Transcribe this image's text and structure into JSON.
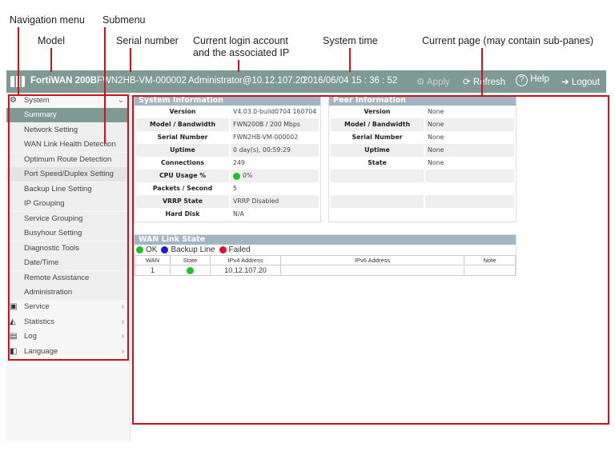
{
  "annotations": {
    "nav_menu": "Navigation menu",
    "submenu": "Submenu",
    "model": "Model",
    "serial": "Serial number",
    "login": "Current login account",
    "login2": "and the associated IP",
    "time": "System time",
    "page": "Current page (may contain sub-panes)"
  },
  "header": {
    "model": "FortiWAN 200B",
    "serial": "FWN2HB-VM-000002",
    "account": "Administrator@10.12.107.20",
    "time": "2016/06/04 15 : 36 : 52",
    "apply": "Apply",
    "refresh": "Refresh",
    "help": "Help",
    "logout": "Logout"
  },
  "colors": {
    "header": "#7f9a95",
    "panel_header": "#a3b4c2",
    "annotation": "#d0111b",
    "ok": "#22c02a",
    "backup": "#1a1ad0",
    "failed": "#e0102c"
  },
  "sidebar": {
    "system": "System",
    "submenu": [
      "Summary",
      "Network Setting",
      "WAN Link Health Detection",
      "Optimum Route Detection",
      "Port Speed/Duplex Setting",
      "Backup Line Setting",
      "IP Grouping",
      "Service Grouping",
      "Busyhour Setting",
      "Diagnostic Tools",
      "Date/Time",
      "Remote Assistance",
      "Administration"
    ],
    "selected": "Summary",
    "menu": [
      {
        "label": "Service",
        "icon": "monitor-icon"
      },
      {
        "label": "Statistics",
        "icon": "chart-icon"
      },
      {
        "label": "Log",
        "icon": "log-icon"
      },
      {
        "label": "Language",
        "icon": "language-icon"
      }
    ]
  },
  "system_info": {
    "title": "System Information",
    "rows": [
      {
        "k": "Version",
        "v": "V4.03.0-build0704 160704"
      },
      {
        "k": "Model / Bandwidth",
        "v": "FWN200B / 200 Mbps"
      },
      {
        "k": "Serial Number",
        "v": "FWN2HB-VM-000002"
      },
      {
        "k": "Uptime",
        "v": "0 day(s), 00:59:29"
      },
      {
        "k": "Connections",
        "v": "249"
      },
      {
        "k": "CPU Usage %",
        "v": "0%"
      },
      {
        "k": "Packets / Second",
        "v": "5"
      },
      {
        "k": "VRRP State",
        "v": "VRRP Disabled"
      },
      {
        "k": "Hard Disk",
        "v": "N/A"
      }
    ]
  },
  "peer_info": {
    "title": "Peer Information",
    "rows": [
      {
        "k": "Version",
        "v": "None"
      },
      {
        "k": "Model / Bandwidth",
        "v": "None"
      },
      {
        "k": "Serial Number",
        "v": "None"
      },
      {
        "k": "Uptime",
        "v": "None"
      },
      {
        "k": "State",
        "v": "None"
      },
      {
        "k": "",
        "v": ""
      },
      {
        "k": "",
        "v": ""
      },
      {
        "k": "",
        "v": ""
      }
    ]
  },
  "wan": {
    "title": "WAN Link State",
    "legend": [
      "OK",
      "Backup Line",
      "Failed"
    ],
    "columns": [
      "WAN",
      "State",
      "IPv4 Address",
      "IPv6 Address",
      "Note"
    ],
    "rows": [
      {
        "wan": "1",
        "state": "ok",
        "ipv4": "10.12.107.20",
        "ipv6": "",
        "note": ""
      }
    ]
  }
}
